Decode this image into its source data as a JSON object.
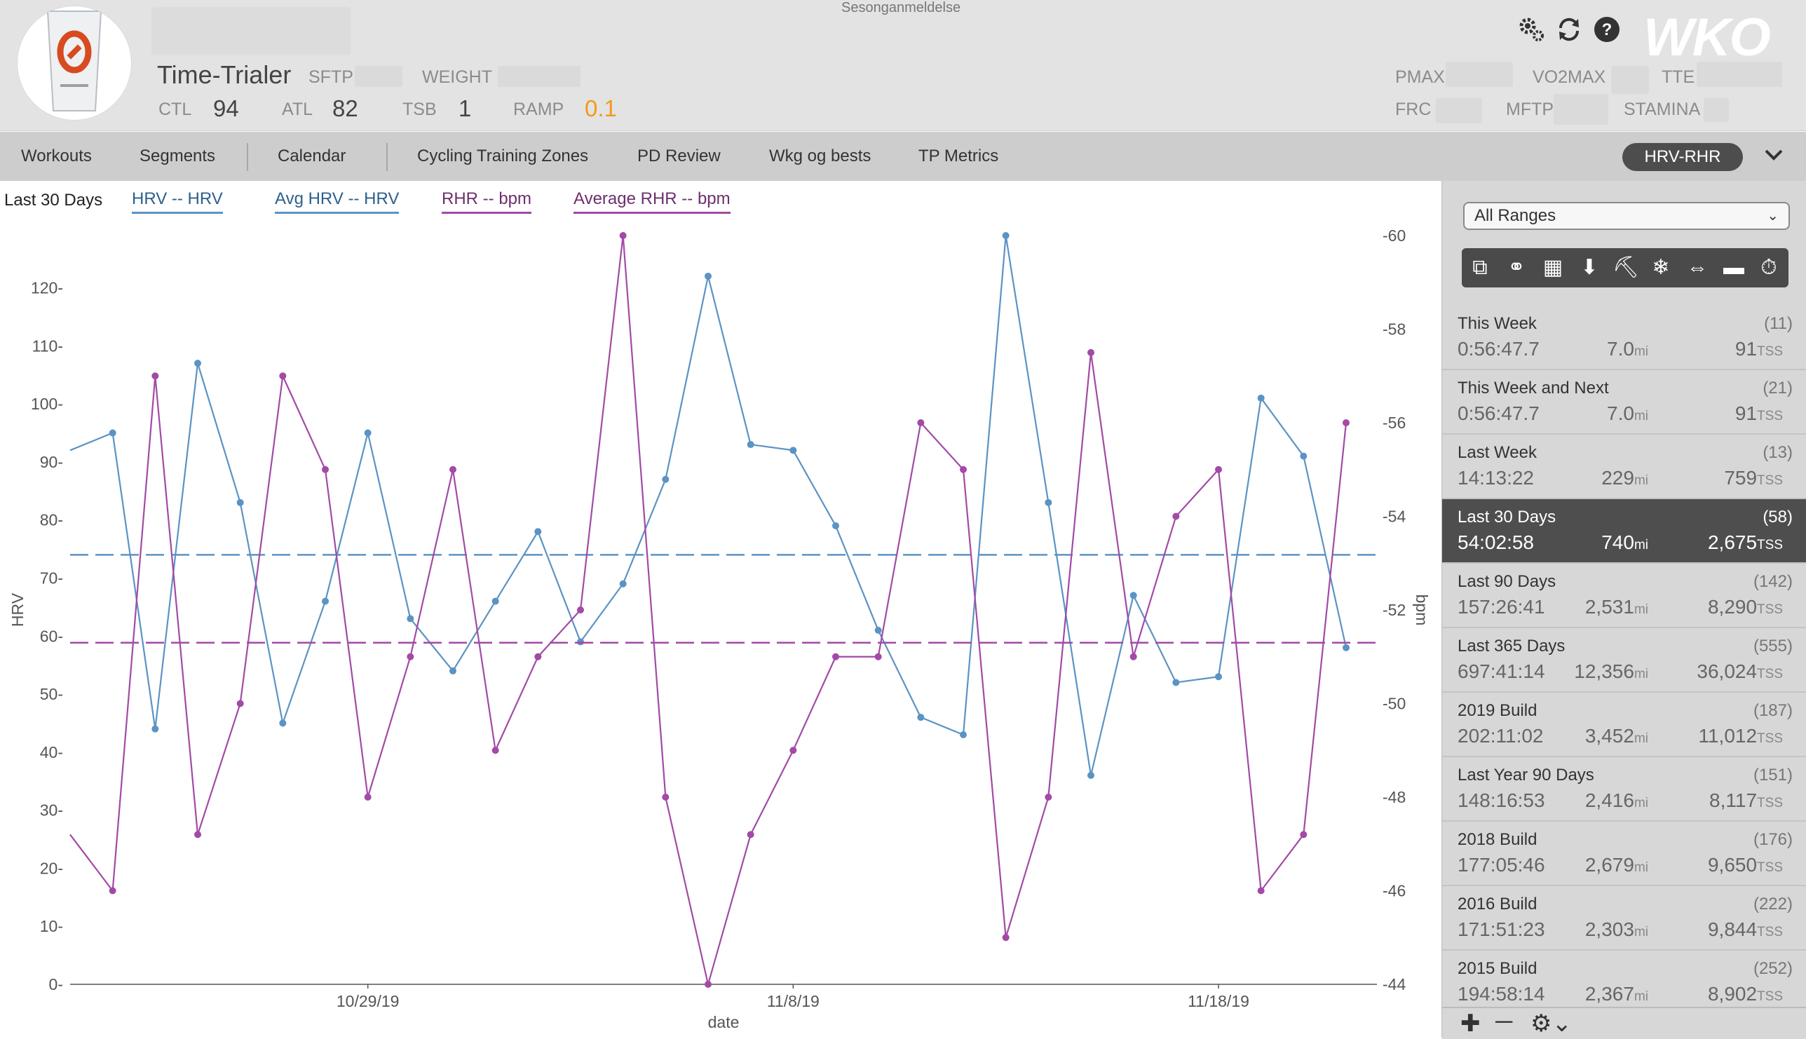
{
  "header": {
    "top_label": "Sesonganmeldelse",
    "athlete_name": "Time-Trialer",
    "labels": {
      "sftp": "SFTP",
      "weight": "WEIGHT",
      "ctl": "CTL",
      "atl": "ATL",
      "tsb": "TSB",
      "ramp": "RAMP",
      "pmax": "PMAX",
      "vo2max": "VO2MAX",
      "tte": "TTE",
      "frc": "FRC",
      "mftp": "MFTP",
      "stamina": "STAMINA"
    },
    "values": {
      "ctl": "94",
      "atl": "82",
      "tsb": "1",
      "ramp": "0.1"
    },
    "logo": "WKO",
    "icons": [
      "gear-icon",
      "refresh-icon",
      "help-icon"
    ],
    "ramp_color": "#f39a1a"
  },
  "nav": {
    "items": [
      "Workouts",
      "Segments",
      "Calendar",
      "Cycling Training Zones",
      "PD Review",
      "Wkg og bests",
      "TP Metrics"
    ],
    "active_chart": "HRV-RHR"
  },
  "chart_header": {
    "range": "Last 30 Days",
    "legend": [
      "HRV  -- HRV",
      "Avg HRV  -- HRV",
      "RHR  -- bpm",
      "Average RHR  -- bpm"
    ]
  },
  "chart_data": {
    "type": "line",
    "xlabel": "date",
    "ylabel_left": "HRV",
    "ylabel_right": "bpm",
    "x_tick_labels": [
      "10/29/19",
      "11/8/19",
      "11/18/19"
    ],
    "x_range": [
      "2019-10-22",
      "2019-11-21"
    ],
    "y_left_range": [
      0,
      129
    ],
    "y_left_ticks": [
      0,
      10,
      20,
      30,
      40,
      50,
      60,
      70,
      80,
      90,
      100,
      110,
      120
    ],
    "y_right_range": [
      -44,
      -60
    ],
    "y_right_ticks": [
      -44,
      -46,
      -48,
      -50,
      -52,
      -54,
      -56,
      -58,
      -60
    ],
    "colors": {
      "hrv": "#5b93c4",
      "rhr": "#a24aa6"
    },
    "series": [
      {
        "name": "HRV",
        "axis": "left",
        "dates": [
          "2019-10-22",
          "2019-10-23",
          "2019-10-24",
          "2019-10-25",
          "2019-10-26",
          "2019-10-27",
          "2019-10-28",
          "2019-10-29",
          "2019-10-30",
          "2019-10-31",
          "2019-11-01",
          "2019-11-02",
          "2019-11-03",
          "2019-11-04",
          "2019-11-05",
          "2019-11-06",
          "2019-11-07",
          "2019-11-08",
          "2019-11-09",
          "2019-11-10",
          "2019-11-11",
          "2019-11-12",
          "2019-11-13",
          "2019-11-14",
          "2019-11-15",
          "2019-11-16",
          "2019-11-17",
          "2019-11-18",
          "2019-11-19",
          "2019-11-20",
          "2019-11-21"
        ],
        "values": [
          92,
          95,
          44,
          107,
          83,
          45,
          66,
          95,
          63,
          54,
          66,
          78,
          59,
          69,
          87,
          122,
          93,
          92,
          79,
          61,
          46,
          43,
          129,
          83,
          36,
          67,
          52,
          53,
          101,
          91,
          58
        ]
      },
      {
        "name": "Avg HRV",
        "axis": "left",
        "dates": [
          "2019-10-22",
          "2019-11-21"
        ],
        "values": [
          74,
          74
        ]
      },
      {
        "name": "RHR",
        "axis": "right",
        "dates": [
          "2019-10-22",
          "2019-10-23",
          "2019-10-24",
          "2019-10-25",
          "2019-10-26",
          "2019-10-27",
          "2019-10-28",
          "2019-10-29",
          "2019-10-30",
          "2019-10-31",
          "2019-11-01",
          "2019-11-02",
          "2019-11-03",
          "2019-11-04",
          "2019-11-05",
          "2019-11-06",
          "2019-11-07",
          "2019-11-08",
          "2019-11-09",
          "2019-11-10",
          "2019-11-11",
          "2019-11-12",
          "2019-11-13",
          "2019-11-14",
          "2019-11-15",
          "2019-11-16",
          "2019-11-17",
          "2019-11-18",
          "2019-11-19",
          "2019-11-20",
          "2019-11-21"
        ],
        "values": [
          -47.2,
          -46.0,
          -57.0,
          -47.2,
          -50.0,
          -57.0,
          -55.0,
          -48.0,
          -51.0,
          -55.0,
          -49.0,
          -51.0,
          -52.0,
          -60.0,
          -48.0,
          -44.0,
          -47.2,
          -49.0,
          -51.0,
          -51.0,
          -56.0,
          -55.0,
          -45.0,
          -48.0,
          -57.5,
          -51.0,
          -54.0,
          -55.0,
          -46.0,
          -47.2,
          -56.0
        ]
      },
      {
        "name": "Average RHR",
        "axis": "right",
        "dates": [
          "2019-10-22",
          "2019-11-21"
        ],
        "values": [
          -51.3,
          -51.3
        ]
      }
    ]
  },
  "sidebar": {
    "range_select": "All Ranges",
    "tool_icons": [
      "copy-icon",
      "bike-icon",
      "swim-icon",
      "run-shoe-icon",
      "shoe-icon",
      "snowflake-icon",
      "dumbbell-icon",
      "rowing-icon",
      "stopwatch-icon"
    ],
    "ranges": [
      {
        "name": "This Week",
        "count": "(11)",
        "time": "0:56:47.7",
        "dist": "7.0",
        "tss": "91"
      },
      {
        "name": "This Week and Next",
        "count": "(21)",
        "time": "0:56:47.7",
        "dist": "7.0",
        "tss": "91"
      },
      {
        "name": "Last Week",
        "count": "(13)",
        "time": "14:13:22",
        "dist": "229",
        "tss": "759"
      },
      {
        "name": "Last 30 Days",
        "count": "(58)",
        "time": "54:02:58",
        "dist": "740",
        "tss": "2,675"
      },
      {
        "name": "Last 90 Days",
        "count": "(142)",
        "time": "157:26:41",
        "dist": "2,531",
        "tss": "8,290"
      },
      {
        "name": "Last 365 Days",
        "count": "(555)",
        "time": "697:41:14",
        "dist": "12,356",
        "tss": "36,024"
      },
      {
        "name": "2019 Build",
        "count": "(187)",
        "time": "202:11:02",
        "dist": "3,452",
        "tss": "11,012"
      },
      {
        "name": "Last Year 90 Days",
        "count": "(151)",
        "time": "148:16:53",
        "dist": "2,416",
        "tss": "8,117"
      },
      {
        "name": "2018 Build",
        "count": "(176)",
        "time": "177:05:46",
        "dist": "2,679",
        "tss": "9,650"
      },
      {
        "name": "2016 Build",
        "count": "(222)",
        "time": "171:51:23",
        "dist": "2,303",
        "tss": "9,844"
      },
      {
        "name": "2015 Build",
        "count": "(252)",
        "time": "194:58:14",
        "dist": "2,367",
        "tss": "8,902"
      }
    ],
    "dist_unit": "mi",
    "tss_unit": "TSS",
    "bottom_icons": [
      "plus-icon",
      "minus-icon",
      "settings-icon"
    ]
  }
}
